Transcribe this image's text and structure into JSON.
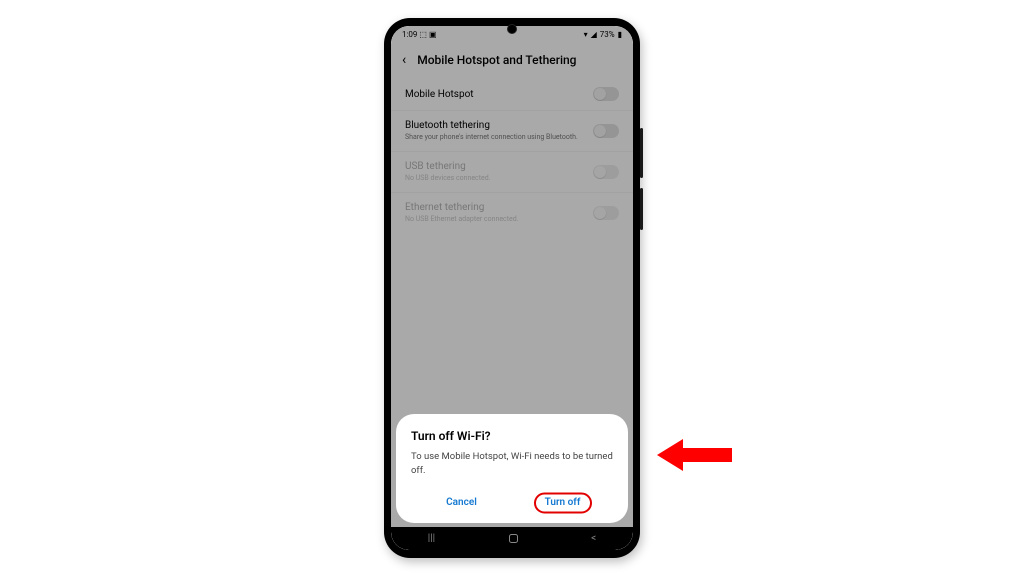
{
  "status": {
    "time": "1:09",
    "battery": "73%"
  },
  "header": {
    "title": "Mobile Hotspot and Tethering"
  },
  "rows": [
    {
      "title": "Mobile Hotspot",
      "sub": ""
    },
    {
      "title": "Bluetooth tethering",
      "sub": "Share your phone's internet connection using Bluetooth."
    },
    {
      "title": "USB tethering",
      "sub": "No USB devices connected."
    },
    {
      "title": "Ethernet tethering",
      "sub": "No USB Ethernet adapter connected."
    }
  ],
  "dialog": {
    "title": "Turn off Wi-Fi?",
    "body": "To use Mobile Hotspot, Wi-Fi needs to be turned off.",
    "cancel": "Cancel",
    "confirm": "Turn off"
  },
  "nav": {
    "recents": "|||",
    "back": "<"
  }
}
